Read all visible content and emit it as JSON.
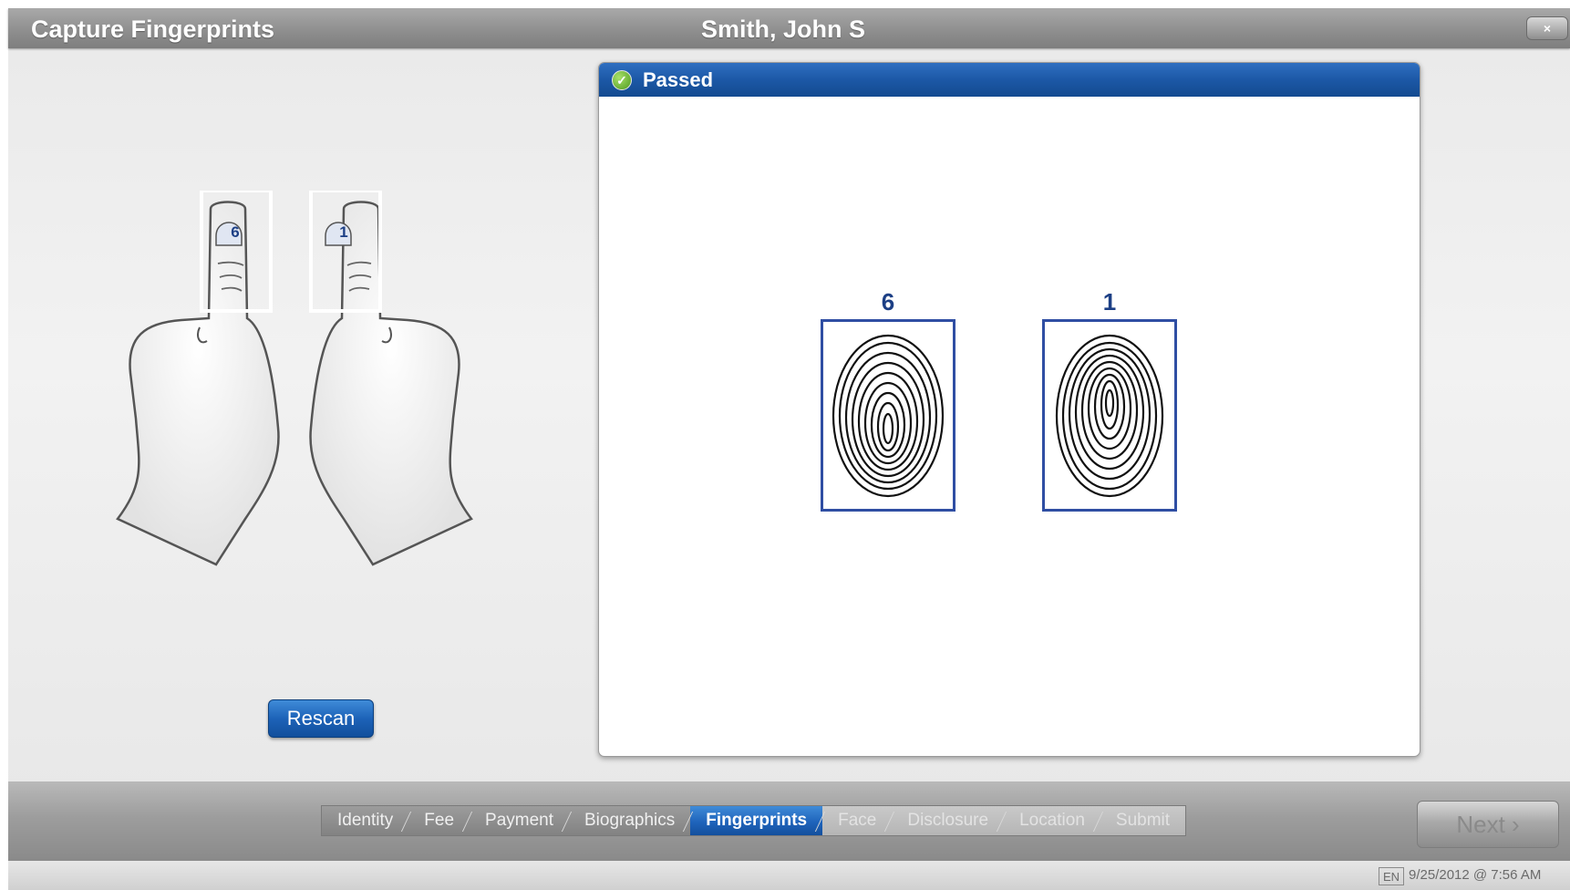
{
  "window": {
    "title": "Capture Fingerprints",
    "person_name": "Smith, John S",
    "close_label": "×"
  },
  "hands": {
    "left_finger_number": "6",
    "right_finger_number": "1"
  },
  "actions": {
    "rescan_label": "Rescan",
    "next_label": "Next ›"
  },
  "result_panel": {
    "status": "Passed",
    "prints": [
      {
        "number": "6"
      },
      {
        "number": "1"
      }
    ]
  },
  "steps": [
    {
      "label": "Identity",
      "state": "done"
    },
    {
      "label": "Fee",
      "state": "done"
    },
    {
      "label": "Payment",
      "state": "done"
    },
    {
      "label": "Biographics",
      "state": "done"
    },
    {
      "label": "Fingerprints",
      "state": "active"
    },
    {
      "label": "Face",
      "state": "future"
    },
    {
      "label": "Disclosure",
      "state": "future"
    },
    {
      "label": "Location",
      "state": "future"
    },
    {
      "label": "Submit",
      "state": "future"
    }
  ],
  "status_bar": {
    "language": "EN",
    "datetime": "9/25/2012 @ 7:56 AM"
  },
  "colors": {
    "accent_blue": "#1f64bb",
    "header_blue": "#1c58a6",
    "print_border": "#2f4ea3",
    "pass_green": "#4d9a1e"
  }
}
